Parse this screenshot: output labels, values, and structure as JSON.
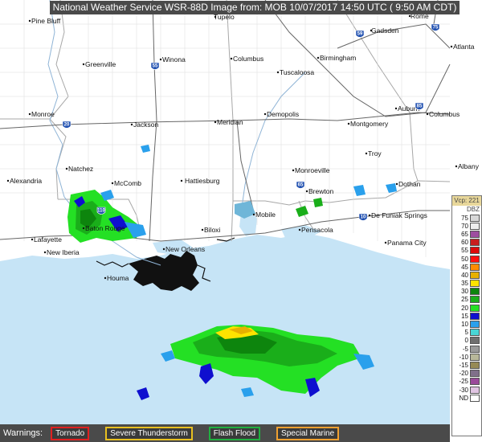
{
  "header": {
    "title": "National Weather Service WSR-88D Image from: MOB 10/07/2017 14:50 UTC ( 9:50 AM CDT)"
  },
  "map": {
    "cities": [
      "Pine Bluff",
      "Tupelo",
      "Gadsden",
      "Rome",
      "Atlanta",
      "Greenville",
      "Winona",
      "Columbus",
      "Birmingham",
      "Tuscaloosa",
      "Monroe",
      "Jackson",
      "Meridian",
      "Demopolis",
      "Montgomery",
      "Auburn",
      "Columbus",
      "Natchez",
      "Hattiesburg",
      "Troy",
      "Alexandria",
      "McComb",
      "Monroeville",
      "Albany",
      "Brewton",
      "Dothan",
      "Lafayette",
      "Baton Rouge",
      "Biloxi",
      "Mobile",
      "Pensacola",
      "De Funiak Springs",
      "New Iberia",
      "New Orleans",
      "Panama City",
      "Houma"
    ],
    "interstates": [
      "59",
      "75",
      "55",
      "10",
      "20",
      "65",
      "85",
      "110"
    ],
    "colors": {
      "land": "#ffffff",
      "water": "#c6e4f6",
      "boundary": "#a7a7a7",
      "road": "#666666"
    }
  },
  "legend": {
    "header": "Vcp: 221",
    "unit": "DBZ",
    "levels": [
      {
        "value": "75",
        "color": "#d8d8d8"
      },
      {
        "value": "70",
        "color": "#eeeeee"
      },
      {
        "value": "65",
        "color": "#9e4ea0"
      },
      {
        "value": "60",
        "color": "#c91f1f"
      },
      {
        "value": "55",
        "color": "#dd0b0b"
      },
      {
        "value": "50",
        "color": "#ff1010"
      },
      {
        "value": "45",
        "color": "#ff8c00"
      },
      {
        "value": "40",
        "color": "#e7b000"
      },
      {
        "value": "35",
        "color": "#ffe300"
      },
      {
        "value": "30",
        "color": "#0d850d"
      },
      {
        "value": "25",
        "color": "#1aae1a"
      },
      {
        "value": "20",
        "color": "#24e024"
      },
      {
        "value": "15",
        "color": "#0f0fcf"
      },
      {
        "value": "10",
        "color": "#2aa0ec"
      },
      {
        "value": "5",
        "color": "#49d6d6"
      },
      {
        "value": "0",
        "color": "#6f6f6f"
      },
      {
        "value": "-5",
        "color": "#9a9a9a"
      },
      {
        "value": "-10",
        "color": "#b8b89a"
      },
      {
        "value": "-15",
        "color": "#968a56"
      },
      {
        "value": "-20",
        "color": "#80708a"
      },
      {
        "value": "-25",
        "color": "#9a4a9a"
      },
      {
        "value": "-30",
        "color": "#e0c4e2"
      },
      {
        "value": "ND",
        "color": "#ffffff"
      }
    ]
  },
  "warnings": {
    "label": "Warnings:",
    "items": [
      {
        "label": "Tornado",
        "color": "#e02020"
      },
      {
        "label": "Severe Thunderstorm",
        "color": "#e8c020"
      },
      {
        "label": "Flash Flood",
        "color": "#20b040"
      },
      {
        "label": "Special Marine",
        "color": "#f0a030"
      }
    ]
  }
}
